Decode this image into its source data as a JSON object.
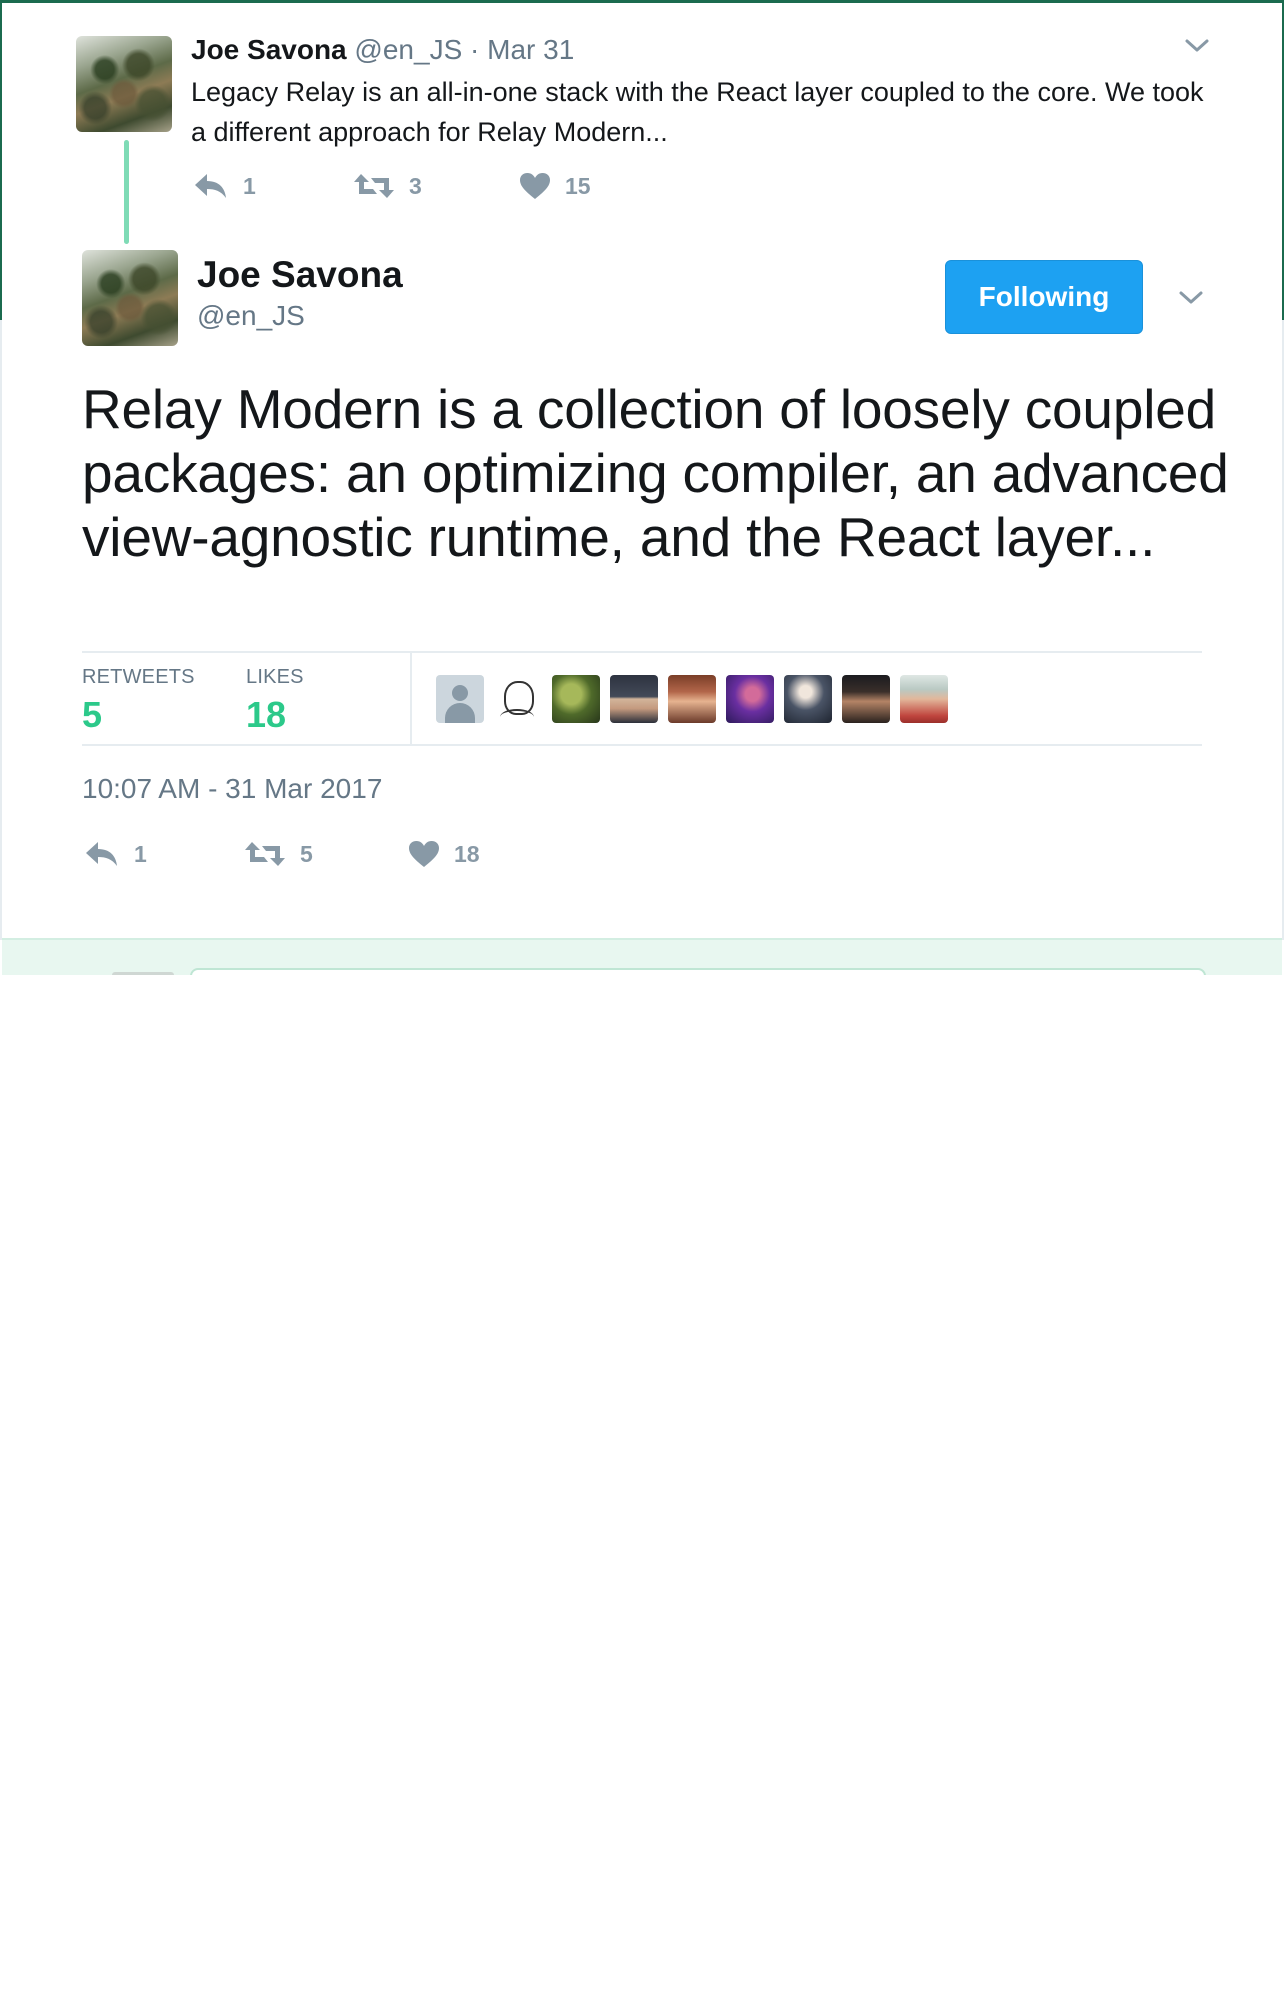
{
  "parent_tweet": {
    "author_name": "Joe Savona",
    "author_handle": "@en_JS",
    "separator": "·",
    "date": "Mar 31",
    "text": "Legacy Relay is an all-in-one stack with the React layer coupled to the core. We took a different approach for Relay Modern...",
    "replies": "1",
    "retweets": "3",
    "likes": "15"
  },
  "main_tweet": {
    "author_name": "Joe Savona",
    "author_handle": "@en_JS",
    "follow_label": "Following",
    "text": "Relay Modern is a collection of loosely coupled packages: an optimizing compiler, an advanced view-agnostic runtime, and the React layer...",
    "stats": {
      "retweets_label": "RETWEETS",
      "retweets_value": "5",
      "likes_label": "LIKES",
      "likes_value": "18"
    },
    "likers": [
      "default-avatar",
      "sketch-avatar",
      "plant-avatar",
      "photo-avatar",
      "photo-avatar",
      "photo-avatar",
      "photo-avatar",
      "photo-avatar",
      "photo-avatar"
    ],
    "timestamp": "10:07 AM - 31 Mar 2017",
    "replies": "1",
    "retweets": "5",
    "likes": "18"
  },
  "colors": {
    "accent_blue": "#1da1f2",
    "stat_green": "#2cc98a",
    "muted": "#657786",
    "thread_line": "#7fdbb6"
  }
}
